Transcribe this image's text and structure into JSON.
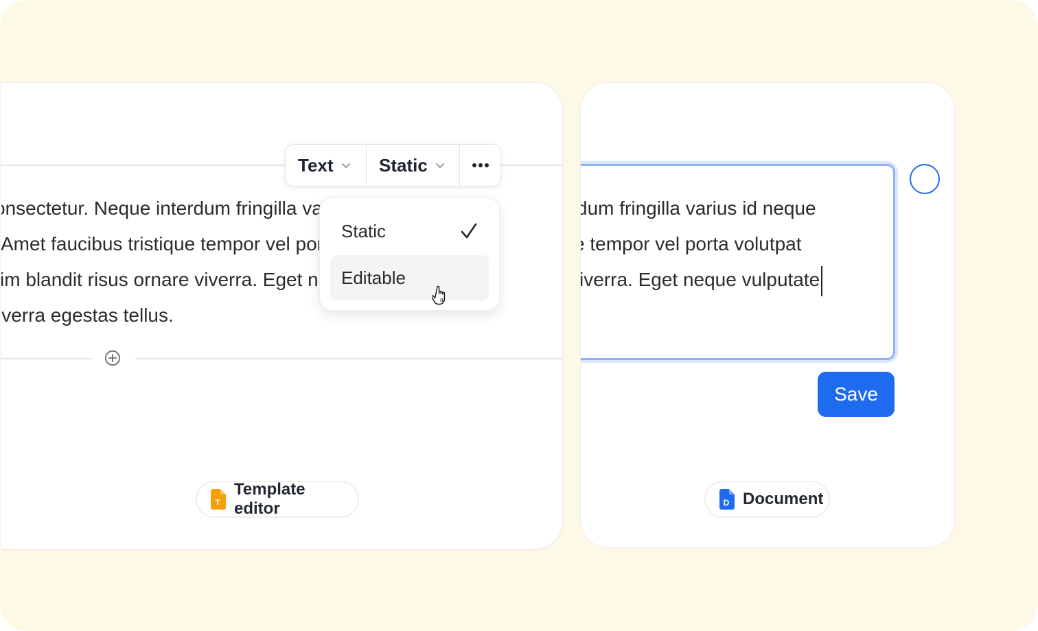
{
  "toolbar": {
    "type_label": "Text",
    "mode_label": "Static",
    "more_icon": "more-horizontal-icon",
    "chevron_icon": "chevron-down-icon"
  },
  "mode_menu": {
    "items": [
      {
        "label": "Static",
        "selected": true
      },
      {
        "label": "Editable",
        "hovered": true
      }
    ]
  },
  "editor": {
    "lines": [
      "onsectetur. Neque interdum fringilla varius id neque",
      " Amet faucibus tristique tempor vel porta volutpat",
      "im blandit risus ornare viverra. Eget neque vulputate",
      "iverra egestas tellus."
    ],
    "add_block_icon": "plus-circle-icon",
    "panel_label": "Template editor",
    "panel_icon": "template-file-icon"
  },
  "document": {
    "lines": [
      "dum fringilla varius id neque",
      "e tempor vel porta volutpat",
      "viverra. Eget neque vulputate"
    ],
    "save_label": "Save",
    "panel_label": "Document",
    "panel_icon": "document-file-icon"
  },
  "colors": {
    "background": "#fef8e6",
    "accent": "#1f6bf0",
    "template_icon": "#f59f0b",
    "field_border": "#8db3f5"
  }
}
